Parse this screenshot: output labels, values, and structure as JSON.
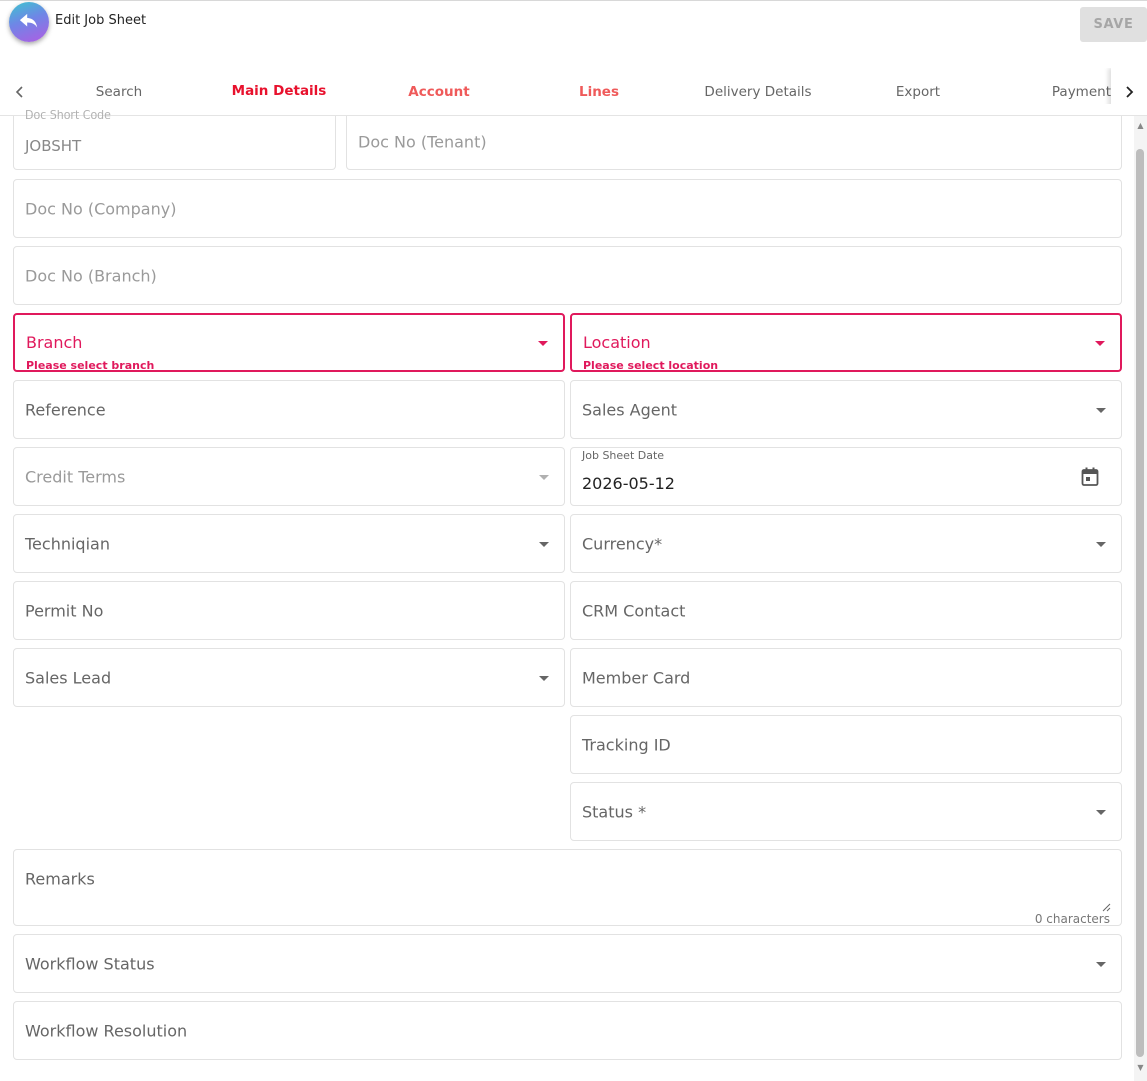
{
  "header": {
    "title": "Edit Job Sheet",
    "save_label": "SAVE",
    "back_icon": "undo-arrow-icon",
    "back_colors": [
      "#3cc6cf",
      "#6f86e6",
      "#b05ce3"
    ]
  },
  "tabs": [
    {
      "label": "Search"
    },
    {
      "label": "Main Details"
    },
    {
      "label": "Account"
    },
    {
      "label": "Lines"
    },
    {
      "label": "Delivery Details"
    },
    {
      "label": "Export"
    },
    {
      "label": "Payment"
    }
  ],
  "form": {
    "doc_short_code": {
      "label": "Doc Short Code",
      "value": "JOBSHT"
    },
    "doc_no_tenant": {
      "label": "Doc No (Tenant)"
    },
    "doc_no_company": {
      "label": "Doc No (Company)"
    },
    "doc_no_branch": {
      "label": "Doc No (Branch)"
    },
    "branch": {
      "label": "Branch",
      "error": "Please select branch"
    },
    "location": {
      "label": "Location",
      "error": "Please select location"
    },
    "reference": {
      "label": "Reference"
    },
    "sales_agent": {
      "label": "Sales Agent"
    },
    "credit_terms": {
      "label": "Credit Terms"
    },
    "job_sheet_date": {
      "label": "Job Sheet Date",
      "value": "2026-05-12"
    },
    "technician": {
      "label": "Techniqian"
    },
    "currency": {
      "label": "Currency*"
    },
    "permit_no": {
      "label": "Permit No"
    },
    "crm_contact": {
      "label": "CRM Contact"
    },
    "sales_lead": {
      "label": "Sales Lead"
    },
    "member_card": {
      "label": "Member Card"
    },
    "tracking_id": {
      "label": "Tracking ID"
    },
    "status": {
      "label": "Status *"
    },
    "remarks": {
      "label": "Remarks",
      "count": "0 characters"
    },
    "workflow_status": {
      "label": "Workflow Status"
    },
    "workflow_resolution": {
      "label": "Workflow Resolution"
    }
  },
  "colors": {
    "accent_error": "#e0195c",
    "active_tab": "#e8112d",
    "tab_underline": "#5b7ed9"
  }
}
